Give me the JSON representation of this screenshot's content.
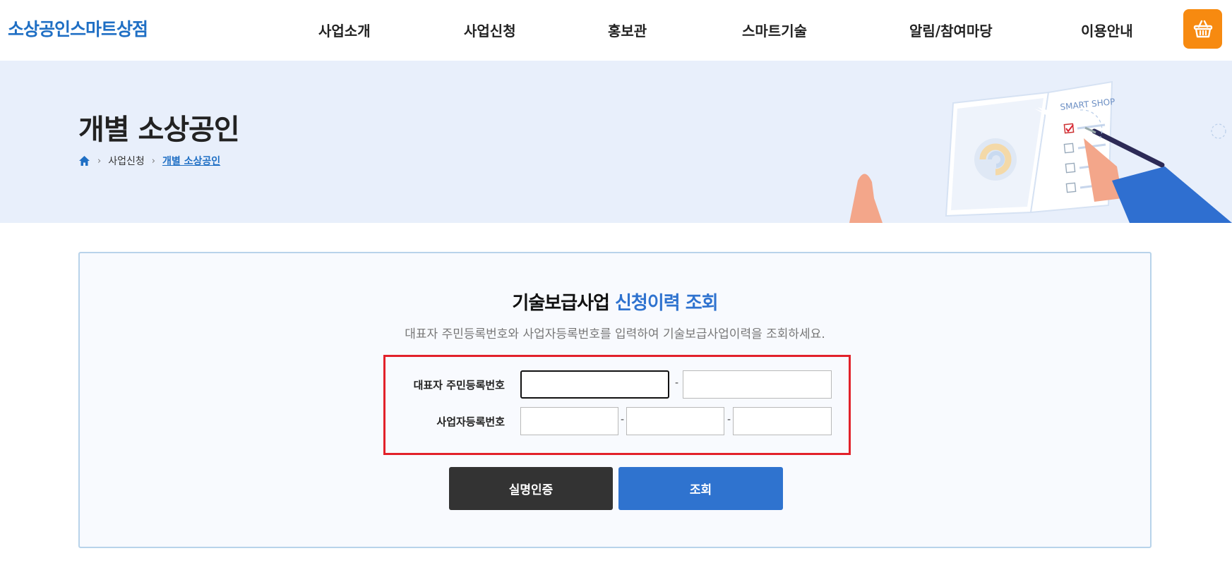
{
  "header": {
    "logo": "소상공인스마트상점",
    "nav": [
      "사업소개",
      "사업신청",
      "홍보관",
      "스마트기술",
      "알림/참여마당",
      "이용안내"
    ],
    "cart_icon": "shopping-basket-icon"
  },
  "banner": {
    "title": "개별 소상공인",
    "breadcrumb": {
      "home_icon": "home-icon",
      "items": [
        "사업신청",
        "개별 소상공인"
      ]
    },
    "illustration_text": "SMART SHOP"
  },
  "form": {
    "title_main": "기술보급사업",
    "title_accent": "신청이력 조회",
    "description": "대표자 주민등록번호와 사업자등록번호를 입력하여 기술보급사업이력을 조회하세요.",
    "rrn_label": "대표자 주민등록번호",
    "brn_label": "사업자등록번호",
    "separator": "-",
    "rrn_fields": [
      "",
      ""
    ],
    "brn_fields": [
      "",
      "",
      ""
    ],
    "verify_button": "실명인증",
    "search_button": "조회"
  },
  "colors": {
    "accent": "#2f73cf",
    "logo": "#1f6fc4",
    "cart": "#f78a10",
    "highlight": "#e2212a",
    "dark_button": "#333333"
  }
}
